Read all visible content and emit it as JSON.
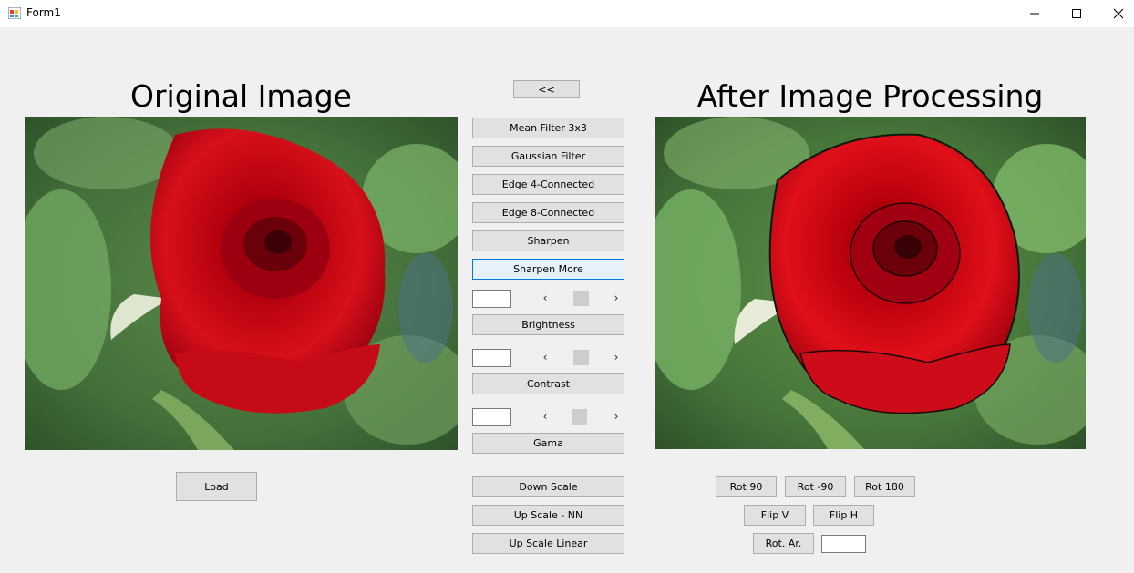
{
  "window": {
    "title": "Form1",
    "controls": [
      "minimize-icon",
      "maximize-icon",
      "close-icon"
    ]
  },
  "headings": {
    "original": "Original Image",
    "processed": "After Image Processing"
  },
  "buttons": {
    "back": "<<",
    "mean_filter": "Mean Filter 3x3",
    "gaussian_filter": "Gaussian Filter",
    "edge4": "Edge 4-Connected",
    "edge8": "Edge 8-Connected",
    "sharpen": "Sharpen",
    "sharpen_more": "Sharpen More",
    "brightness": "Brightness",
    "contrast": "Contrast",
    "gama": "Gama",
    "down_scale": "Down Scale",
    "up_scale_nn": "Up Scale - NN",
    "up_scale_linear": "Up Scale Linear",
    "load": "Load",
    "rot90": "Rot 90",
    "rot_neg90": "Rot -90",
    "rot180": "Rot 180",
    "flip_v": "Flip V",
    "flip_h": "Flip H",
    "rot_ar": "Rot. Ar."
  },
  "inputs": {
    "brightness_value": "",
    "contrast_value": "",
    "gama_value": "",
    "rot_ar_value": ""
  },
  "scrollbars": {
    "left_arrow": "‹",
    "right_arrow": "›"
  },
  "images": {
    "original": "red-rose-photo",
    "processed": "red-rose-sharpened-photo"
  },
  "colors": {
    "window_bg": "#f0f0f0",
    "button_bg": "#e1e1e1",
    "focus_border": "#0078d7"
  }
}
